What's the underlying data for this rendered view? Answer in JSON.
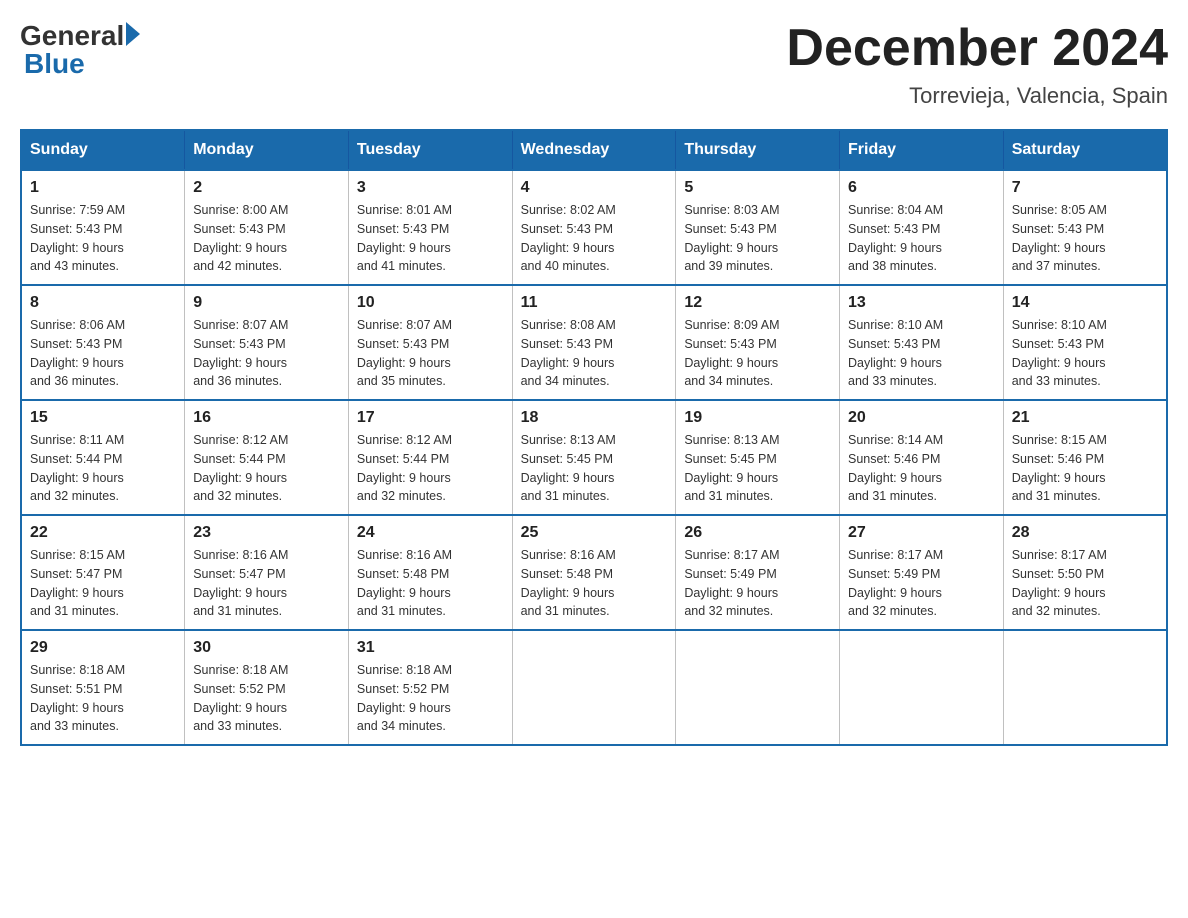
{
  "header": {
    "logo_general": "General",
    "logo_blue": "Blue",
    "month_title": "December 2024",
    "location": "Torrevieja, Valencia, Spain"
  },
  "weekdays": [
    "Sunday",
    "Monday",
    "Tuesday",
    "Wednesday",
    "Thursday",
    "Friday",
    "Saturday"
  ],
  "weeks": [
    [
      {
        "day": "1",
        "sunrise": "7:59 AM",
        "sunset": "5:43 PM",
        "daylight": "9 hours and 43 minutes."
      },
      {
        "day": "2",
        "sunrise": "8:00 AM",
        "sunset": "5:43 PM",
        "daylight": "9 hours and 42 minutes."
      },
      {
        "day": "3",
        "sunrise": "8:01 AM",
        "sunset": "5:43 PM",
        "daylight": "9 hours and 41 minutes."
      },
      {
        "day": "4",
        "sunrise": "8:02 AM",
        "sunset": "5:43 PM",
        "daylight": "9 hours and 40 minutes."
      },
      {
        "day": "5",
        "sunrise": "8:03 AM",
        "sunset": "5:43 PM",
        "daylight": "9 hours and 39 minutes."
      },
      {
        "day": "6",
        "sunrise": "8:04 AM",
        "sunset": "5:43 PM",
        "daylight": "9 hours and 38 minutes."
      },
      {
        "day": "7",
        "sunrise": "8:05 AM",
        "sunset": "5:43 PM",
        "daylight": "9 hours and 37 minutes."
      }
    ],
    [
      {
        "day": "8",
        "sunrise": "8:06 AM",
        "sunset": "5:43 PM",
        "daylight": "9 hours and 36 minutes."
      },
      {
        "day": "9",
        "sunrise": "8:07 AM",
        "sunset": "5:43 PM",
        "daylight": "9 hours and 36 minutes."
      },
      {
        "day": "10",
        "sunrise": "8:07 AM",
        "sunset": "5:43 PM",
        "daylight": "9 hours and 35 minutes."
      },
      {
        "day": "11",
        "sunrise": "8:08 AM",
        "sunset": "5:43 PM",
        "daylight": "9 hours and 34 minutes."
      },
      {
        "day": "12",
        "sunrise": "8:09 AM",
        "sunset": "5:43 PM",
        "daylight": "9 hours and 34 minutes."
      },
      {
        "day": "13",
        "sunrise": "8:10 AM",
        "sunset": "5:43 PM",
        "daylight": "9 hours and 33 minutes."
      },
      {
        "day": "14",
        "sunrise": "8:10 AM",
        "sunset": "5:43 PM",
        "daylight": "9 hours and 33 minutes."
      }
    ],
    [
      {
        "day": "15",
        "sunrise": "8:11 AM",
        "sunset": "5:44 PM",
        "daylight": "9 hours and 32 minutes."
      },
      {
        "day": "16",
        "sunrise": "8:12 AM",
        "sunset": "5:44 PM",
        "daylight": "9 hours and 32 minutes."
      },
      {
        "day": "17",
        "sunrise": "8:12 AM",
        "sunset": "5:44 PM",
        "daylight": "9 hours and 32 minutes."
      },
      {
        "day": "18",
        "sunrise": "8:13 AM",
        "sunset": "5:45 PM",
        "daylight": "9 hours and 31 minutes."
      },
      {
        "day": "19",
        "sunrise": "8:13 AM",
        "sunset": "5:45 PM",
        "daylight": "9 hours and 31 minutes."
      },
      {
        "day": "20",
        "sunrise": "8:14 AM",
        "sunset": "5:46 PM",
        "daylight": "9 hours and 31 minutes."
      },
      {
        "day": "21",
        "sunrise": "8:15 AM",
        "sunset": "5:46 PM",
        "daylight": "9 hours and 31 minutes."
      }
    ],
    [
      {
        "day": "22",
        "sunrise": "8:15 AM",
        "sunset": "5:47 PM",
        "daylight": "9 hours and 31 minutes."
      },
      {
        "day": "23",
        "sunrise": "8:16 AM",
        "sunset": "5:47 PM",
        "daylight": "9 hours and 31 minutes."
      },
      {
        "day": "24",
        "sunrise": "8:16 AM",
        "sunset": "5:48 PM",
        "daylight": "9 hours and 31 minutes."
      },
      {
        "day": "25",
        "sunrise": "8:16 AM",
        "sunset": "5:48 PM",
        "daylight": "9 hours and 31 minutes."
      },
      {
        "day": "26",
        "sunrise": "8:17 AM",
        "sunset": "5:49 PM",
        "daylight": "9 hours and 32 minutes."
      },
      {
        "day": "27",
        "sunrise": "8:17 AM",
        "sunset": "5:49 PM",
        "daylight": "9 hours and 32 minutes."
      },
      {
        "day": "28",
        "sunrise": "8:17 AM",
        "sunset": "5:50 PM",
        "daylight": "9 hours and 32 minutes."
      }
    ],
    [
      {
        "day": "29",
        "sunrise": "8:18 AM",
        "sunset": "5:51 PM",
        "daylight": "9 hours and 33 minutes."
      },
      {
        "day": "30",
        "sunrise": "8:18 AM",
        "sunset": "5:52 PM",
        "daylight": "9 hours and 33 minutes."
      },
      {
        "day": "31",
        "sunrise": "8:18 AM",
        "sunset": "5:52 PM",
        "daylight": "9 hours and 34 minutes."
      },
      null,
      null,
      null,
      null
    ]
  ],
  "labels": {
    "sunrise": "Sunrise:",
    "sunset": "Sunset:",
    "daylight": "Daylight:"
  }
}
